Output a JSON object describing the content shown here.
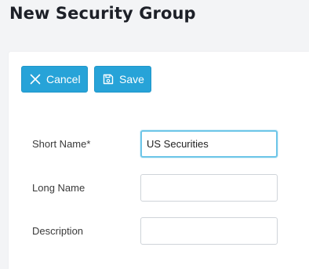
{
  "page": {
    "title": "New Security Group"
  },
  "toolbar": {
    "cancel_label": "Cancel",
    "cancel_icon": "close-icon",
    "save_label": "Save",
    "save_icon": "save-icon"
  },
  "form": {
    "short_name": {
      "label": "Short Name*",
      "value": "US Securities"
    },
    "long_name": {
      "label": "Long Name",
      "value": ""
    },
    "description": {
      "label": "Description",
      "value": ""
    }
  },
  "colors": {
    "button_bg": "#27a3d8",
    "focus_border": "#6ec6e8",
    "page_bg": "#f3f4f6"
  }
}
